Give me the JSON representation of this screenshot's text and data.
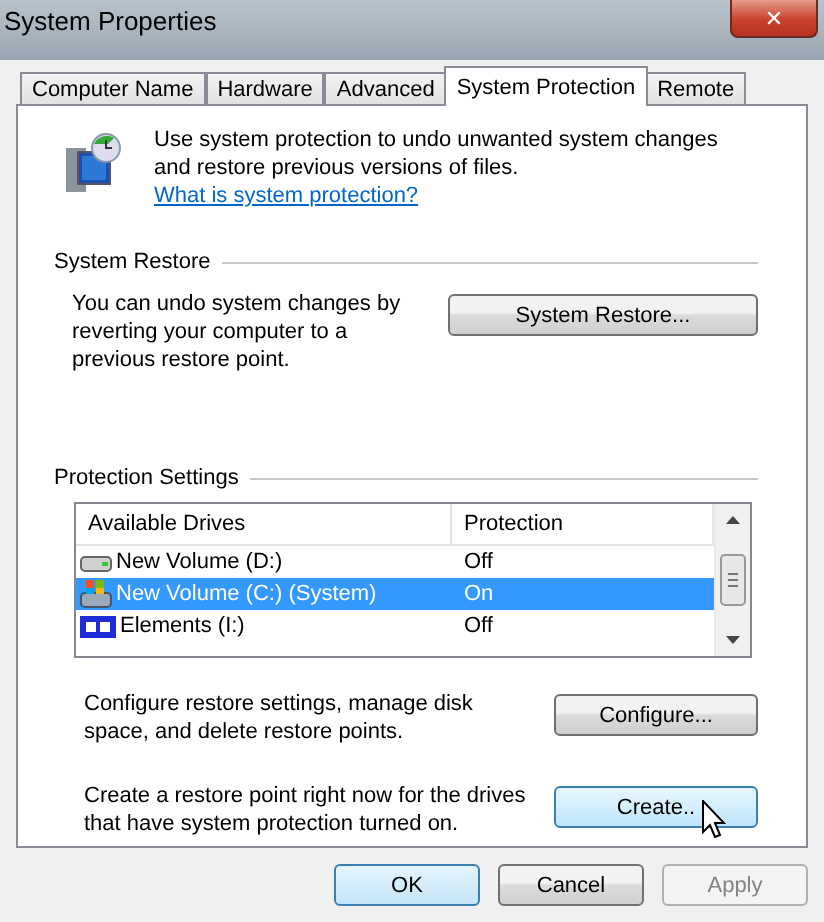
{
  "window": {
    "title": "System Properties",
    "close": "✕"
  },
  "tabs": [
    {
      "label": "Computer Name",
      "selected": false
    },
    {
      "label": "Hardware",
      "selected": false
    },
    {
      "label": "Advanced",
      "selected": false
    },
    {
      "label": "System Protection",
      "selected": true
    },
    {
      "label": "Remote",
      "selected": false
    }
  ],
  "intro": {
    "text": "Use system protection to undo unwanted system changes and restore previous versions of files.",
    "link": "What is system protection?"
  },
  "system_restore": {
    "heading": "System Restore",
    "text": "You can undo system changes by reverting your computer to a previous restore point.",
    "button": "System Restore..."
  },
  "protection_settings": {
    "heading": "Protection Settings",
    "columns": [
      "Available Drives",
      "Protection"
    ],
    "drives": [
      {
        "kind": "disk",
        "name": "New Volume (D:)",
        "protection": "Off",
        "selected": false
      },
      {
        "kind": "system",
        "name": "New Volume (C:) (System)",
        "protection": "On",
        "selected": true
      },
      {
        "kind": "external",
        "name": "Elements (I:)",
        "protection": "Off",
        "selected": false
      }
    ],
    "configure_text": "Configure restore settings, manage disk space, and delete restore points.",
    "configure_button": "Configure...",
    "create_text": "Create a restore point right now for the drives that have system protection turned on.",
    "create_button": {
      "label": "Create..",
      "hovered": true
    }
  },
  "buttons": [
    {
      "label": "OK",
      "kind": "default",
      "disabled": false
    },
    {
      "label": "Cancel",
      "kind": "normal",
      "disabled": false
    },
    {
      "label": "Apply",
      "kind": "normal",
      "disabled": true
    }
  ]
}
